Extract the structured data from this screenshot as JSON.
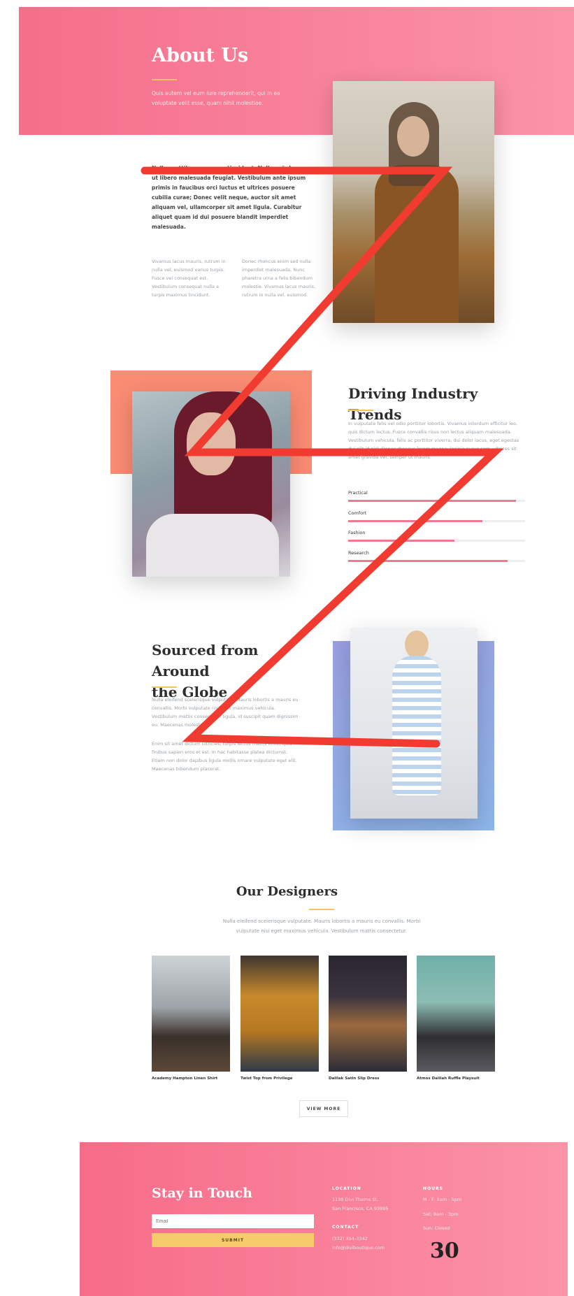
{
  "hero": {
    "title": "About Us",
    "subtitle": "Quis autem vel eum iure reprehenderit, qui in ea voluptate velit esse, quam nihil molestiae."
  },
  "about": {
    "bold_paragraph": "Nulla porttitor accumsan tincidunt. Nulla quis lorem ut libero malesuada feugiat. Vestibulum ante ipsum primis in faucibus orci luctus et ultrices posuere cubilia curae; Donec velit neque, auctor sit amet aliquam vel, ullamcorper sit amet ligula. Curabitur aliquet quam id dui posuere blandit imperdiet malesuada.",
    "col1": "Vivamus lacus mauris, rutrum in nulla vel, euismod varius turpis. Fusce vel consequat est. Vestibulum consequat nulla a turpis maximus tincidunt.",
    "col2": "Donec rhoncus enim sed nulla imperdiet malesuada. Nunc pharetra urna a felis bibendum molestie. Vivamus lacus mauris, rutrum in nulla vel, euismod."
  },
  "trends": {
    "title": "Driving Industry Trends",
    "paragraph": "In vulputate felis vel odio porttitor lobortis. Vivamus interdum efficitur leo, quis dictum lectus. Fusce convallis risus non lectus aliquam malesuada. Vestibulum vehicula, felis ac porttitor viverra, dui dolor lacus, eget egestas dui elit id nisl. Donec rhoncus lorem magna, lacinia purus sem, ultrices sit amet gravida vel, semper ut mauris.",
    "skills": [
      {
        "label": "Practical",
        "value": 0.95
      },
      {
        "label": "Comfort",
        "value": 0.76
      },
      {
        "label": "Fashion",
        "value": 0.6
      },
      {
        "label": "Research",
        "value": 0.9
      }
    ]
  },
  "sourced": {
    "title_line1": "Sourced from Around",
    "title_line2": "the Globe",
    "paragraph1": "Nulla eleifend scelerisque vulputate. Mauris lobortis a mauris eu convallis. Morbi vulputate nisi eget maximus vehicula. Vestibulum mattis consectetur ligula, id suscipit quam dignissim eu. Maecenas molestie.",
    "paragraph2": "Enim sit amet dictum ultricies, turpis lectus mattis enim, quis finibus sapien eros et est. In hac habitasse platea dictumst. Etiam non dolor dapibus ligula mollis ornare vulputate eget elit. Maecenas bibendum placerat."
  },
  "designers": {
    "title": "Our Designers",
    "subtitle": "Nulla eleifend scelerisque vulputate. Mauris lobortis a mauris eu convallis. Morbi vulputate nisi eget maximus vehicula. Vestibulum mattis consectetur.",
    "items": [
      {
        "caption": "Academy Hampton Linen Shirt"
      },
      {
        "caption": "Twist Top from Privilege"
      },
      {
        "caption": "Dalilak Satin Slip Dress"
      },
      {
        "caption": "Atmos Dalilah Ruffle Playsuit"
      }
    ],
    "view_more": "VIEW MORE"
  },
  "footer": {
    "title": "Stay in Touch",
    "email_placeholder": "Email",
    "submit": "SUBMIT",
    "location_head": "LOCATION",
    "location_line1": "1130 Divi Theme St.",
    "location_line2": "San Francisco, CA 93995",
    "contact_head": "CONTACT",
    "phone": "(332) 394-3342",
    "email": "info@diviboutique.com",
    "hours_head": "HOURS",
    "hours": [
      "M - F: 8am - 5pm",
      "Sat: 9am - 3pm",
      "Sun: Closed"
    ]
  },
  "annotation_label": "30",
  "colors": {
    "brand_pink": "#f56e8a",
    "accent_yellow": "#f6c65b",
    "coral": "#f98c73",
    "periwinkle": "#9a9fe0",
    "annotation_red": "#f23b30"
  }
}
